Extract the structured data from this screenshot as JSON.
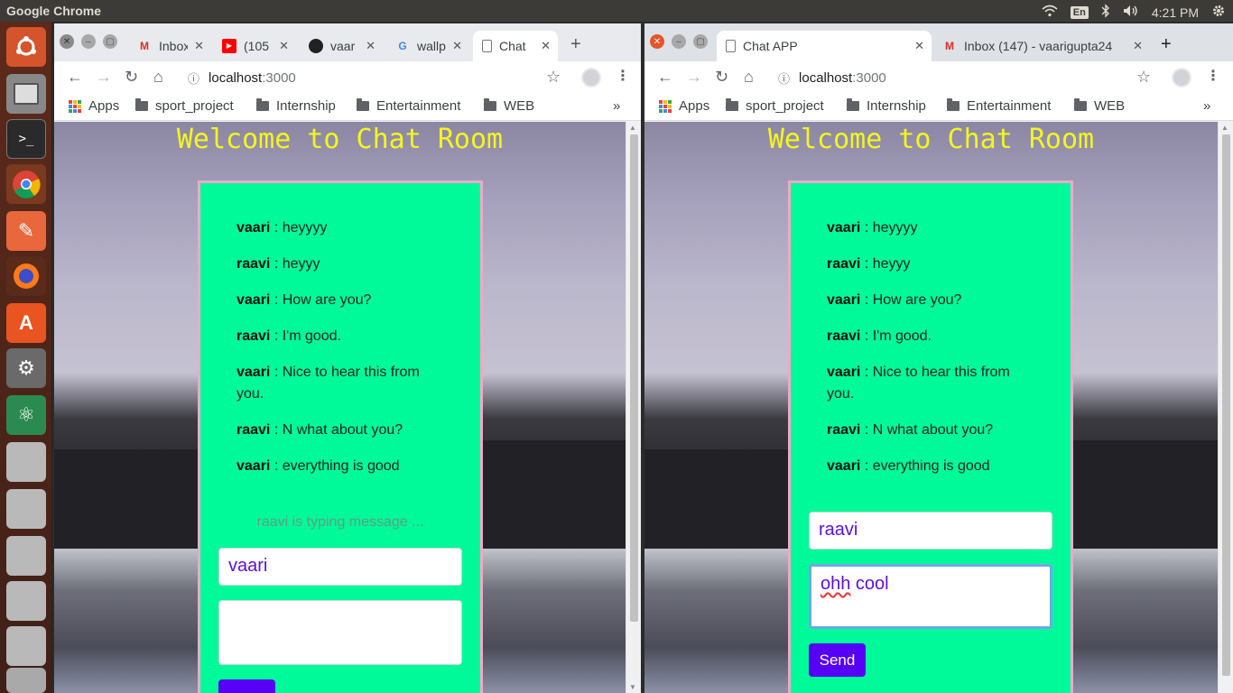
{
  "desktop": {
    "app_name": "Google Chrome",
    "keyboard_layout": "En",
    "clock": "4:21 PM"
  },
  "left_window": {
    "tabs": [
      {
        "title": "Inbox",
        "icon": "gmail-icon"
      },
      {
        "title": "(105",
        "icon": "youtube-icon"
      },
      {
        "title": "vaar",
        "icon": "github-icon"
      },
      {
        "title": "wallp",
        "icon": "google-icon"
      },
      {
        "title": "Chat",
        "icon": "page-icon"
      }
    ],
    "url_host": "localhost",
    "url_port": ":3000",
    "bookmarks": [
      "Apps",
      "sport_project",
      "Internship",
      "Entertainment",
      "WEB"
    ],
    "page": {
      "heading": "Welcome to Chat Room",
      "messages": [
        {
          "user": "vaari",
          "text": " : heyyyy"
        },
        {
          "user": "raavi",
          "text": " : heyyy"
        },
        {
          "user": "vaari",
          "text": " : How are you?"
        },
        {
          "user": "raavi",
          "text": " : I'm good."
        },
        {
          "user": "vaari",
          "text": " : Nice to hear this from you."
        },
        {
          "user": "raavi",
          "text": " : N what about you?"
        },
        {
          "user": "vaari",
          "text": " : everything is good"
        }
      ],
      "typing_status": "raavi is typing message ...",
      "name_value": "vaari",
      "message_value": ""
    }
  },
  "right_window": {
    "tabs": [
      {
        "title": "Chat APP",
        "icon": "page-icon"
      },
      {
        "title": "Inbox (147) - vaarigupta24",
        "icon": "gmail-icon"
      }
    ],
    "url_host": "localhost",
    "url_port": ":3000",
    "bookmarks": [
      "Apps",
      "sport_project",
      "Internship",
      "Entertainment",
      "WEB"
    ],
    "page": {
      "heading": "Welcome to Chat Room",
      "messages": [
        {
          "user": "vaari",
          "text": " : heyyyy"
        },
        {
          "user": "raavi",
          "text": " : heyyy"
        },
        {
          "user": "vaari",
          "text": " : How are you?"
        },
        {
          "user": "raavi",
          "text": " : I'm good."
        },
        {
          "user": "vaari",
          "text": " : Nice to hear this from you."
        },
        {
          "user": "raavi",
          "text": " : N what about you?"
        },
        {
          "user": "vaari",
          "text": " : everything is good"
        }
      ],
      "name_value": "raavi",
      "message_value_word1": "ohh",
      "message_value_rest": " cool",
      "send_label": "Send"
    }
  },
  "colors": {
    "panel": "#00fa9a",
    "heading": "#f5f51e",
    "send_button": "#5600f5",
    "input_text": "#5b10e0"
  }
}
